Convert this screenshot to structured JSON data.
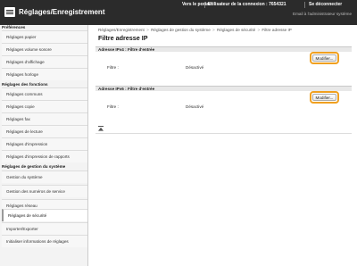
{
  "header": {
    "title": "Réglages/Enregistrement",
    "portal_link": "Vers le portail",
    "login_user_label": "Utilisateur de la connexion : ",
    "login_user_value": "7654321",
    "logout_link": "Se déconnecter",
    "admin_email_link": "Email à l'administrateur système"
  },
  "sidebar": {
    "group_preferences": "Préférences",
    "items_preferences": [
      "Réglages papier",
      "Réglages volume sonore",
      "Réglages d'affichage",
      "Réglages horloge"
    ],
    "group_functions": "Réglages des fonctions",
    "items_functions": [
      "Réglages communs",
      "Réglages copie",
      "Réglages fax",
      "Réglages de lecture",
      "Réglages d'impression",
      "Réglages d'impression de rapports"
    ],
    "group_management": "Réglages de gestion du système",
    "items_management": [
      "Gestion du système",
      "Gestion des numéros de service",
      "Réglages réseau",
      "Réglages de sécurité",
      "Importer/Exporter",
      "Initialiser informations de réglages"
    ]
  },
  "breadcrumb": {
    "items": [
      "Réglages/Enregistrement",
      "Réglages de gestion du système",
      "Réglages de sécurité",
      "Filtre adresse IP"
    ],
    "separator": ">"
  },
  "page_title": "Filtre adresse IP",
  "sections": [
    {
      "title": "Adresse IPv4 : Filtre d'entrée",
      "field_label": "Filtre :",
      "field_value": "Désactivé",
      "button_label": "Modifier..."
    },
    {
      "title": "Adresse IPv6 : Filtre d'entrée",
      "field_label": "Filtre :",
      "field_value": "Désactivé",
      "button_label": "Modifier..."
    }
  ],
  "icons": {
    "brand": "settings-registration-icon",
    "back_to_top": "back-to-top-icon"
  },
  "colors": {
    "header_bg": "#2b2b2b",
    "highlight": "#f0a020",
    "sidebar_bg": "#f3f3f3"
  }
}
